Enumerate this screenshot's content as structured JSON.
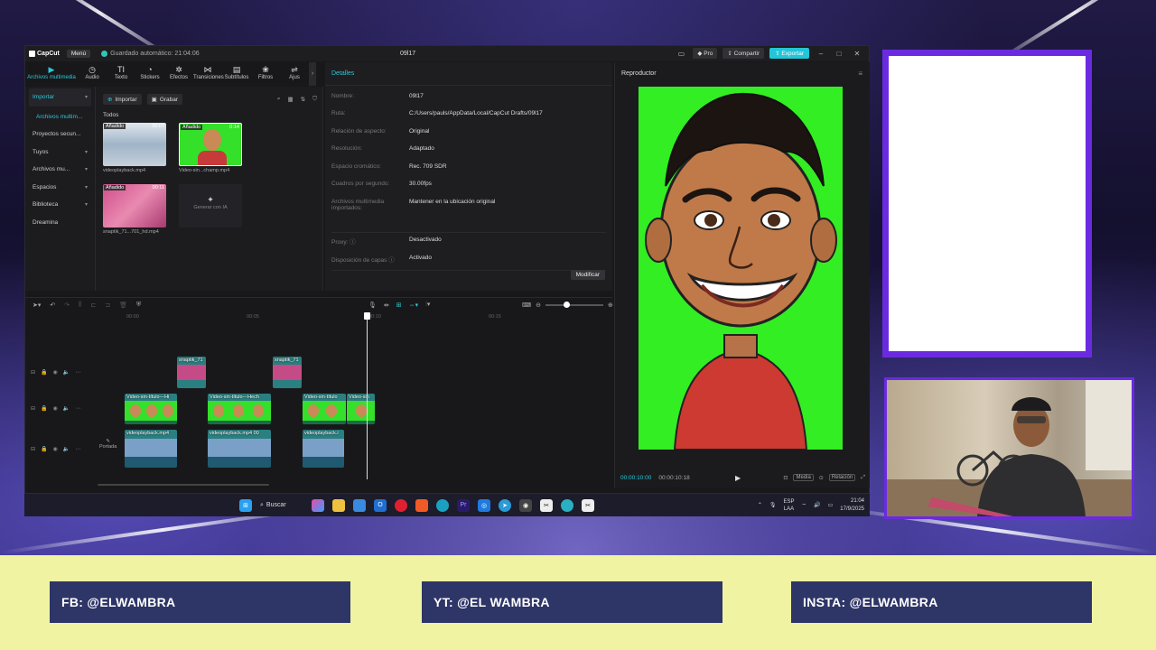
{
  "window": {
    "app_name": "CapCut",
    "menu_label": "Menú",
    "autosave": "Guardado automático: 21:04:06",
    "project_title": "09l17",
    "pro_label": "Pro",
    "share_label": "Compartir",
    "export_label": "Exportar"
  },
  "tools": [
    {
      "label": "Archivos multimedia",
      "icon": "media-icon",
      "glyph": "▶"
    },
    {
      "label": "Audio",
      "icon": "audio-icon",
      "glyph": "◷"
    },
    {
      "label": "Texto",
      "icon": "text-icon",
      "glyph": "TI"
    },
    {
      "label": "Stickers",
      "icon": "sticker-icon",
      "glyph": "◔"
    },
    {
      "label": "Efectos",
      "icon": "effects-icon",
      "glyph": "✲"
    },
    {
      "label": "Transiciones",
      "icon": "transitions-icon",
      "glyph": "⋈"
    },
    {
      "label": "Subtítulos",
      "icon": "subtitles-icon",
      "glyph": "▤"
    },
    {
      "label": "Filtros",
      "icon": "filters-icon",
      "glyph": "❀"
    },
    {
      "label": "Ajus",
      "icon": "adjust-icon",
      "glyph": "⇌"
    }
  ],
  "media_sidebar": {
    "import": "Importar",
    "items": [
      "Archivos multim...",
      "Proyectos secun...",
      "Tuyos",
      "Archivos mu...",
      "Espacios",
      "Biblioteca",
      "Dreamina"
    ]
  },
  "media": {
    "import_tab": "Importar",
    "record_tab": "Grabar",
    "all_label": "Todos",
    "added_badge": "Añadido",
    "items": [
      {
        "caption": "videoplayback.mp4",
        "duration": "00:07"
      },
      {
        "caption": "Video-sin...champ.mp4",
        "duration": "0:14"
      },
      {
        "caption": "snaptik_71...701_hd.mp4",
        "duration": "00:11"
      }
    ],
    "generate_label": "Generar con IA"
  },
  "details": {
    "header": "Detalles",
    "rows": [
      {
        "k": "Nombre:",
        "v": "09l17"
      },
      {
        "k": "Ruta:",
        "v": "C:/Users/pauls/AppData/Local/CapCut Drafts/09l17"
      },
      {
        "k": "Relación de aspecto:",
        "v": "Original"
      },
      {
        "k": "Resolución:",
        "v": "Adaptado"
      },
      {
        "k": "Espacio cromático:",
        "v": "Rec. 709 SDR"
      },
      {
        "k": "Cuadros por segundo:",
        "v": "30.00fps"
      },
      {
        "k": "Archivos multimedia importados:",
        "v": "Mantener en la ubicación original"
      },
      {
        "k": "Proxy: ⓘ",
        "v": "Desactivado"
      },
      {
        "k": "Disposición de capas ⓘ",
        "v": "Activado"
      }
    ],
    "modify_button": "Modificar"
  },
  "player": {
    "header": "Reproductor",
    "current_time": "00:00:10:00",
    "total_time": "00:00:10:18",
    "media_label": "Media",
    "ratio_label": "Relación"
  },
  "timeline": {
    "ruler": [
      "00:00",
      "00:05",
      "00:10",
      "00:15"
    ],
    "cover_label": "Portada",
    "clips": {
      "pink1": "snaptik_71",
      "pink2": "snaptik_71",
      "green1": "Video-sin-título---Hi",
      "green2": "Video-sin-título---Hech",
      "green3": "Video-sin-título",
      "green4": "Video-sin",
      "blue1": "videoplayback.mp4",
      "blue2": "videoplayback.mp4",
      "blue2_tail": "00",
      "blue3": "videoplayback.i"
    }
  },
  "taskbar": {
    "search": "Buscar",
    "lang_top": "ESP",
    "lang_bottom": "LAA",
    "time": "21:04",
    "date": "17/9/2025"
  },
  "banner": {
    "fb": "FB: @ELWAMBRA",
    "yt": "YT: @EL WAMBRA",
    "insta": "INSTA: @ELWAMBRA"
  },
  "colors": {
    "accent": "#2ec7d8",
    "banner_bg": "#f0f3a2",
    "banner_box": "#2e3567",
    "frame_purple": "#6a2be0",
    "chroma_green": "#33ee22"
  }
}
